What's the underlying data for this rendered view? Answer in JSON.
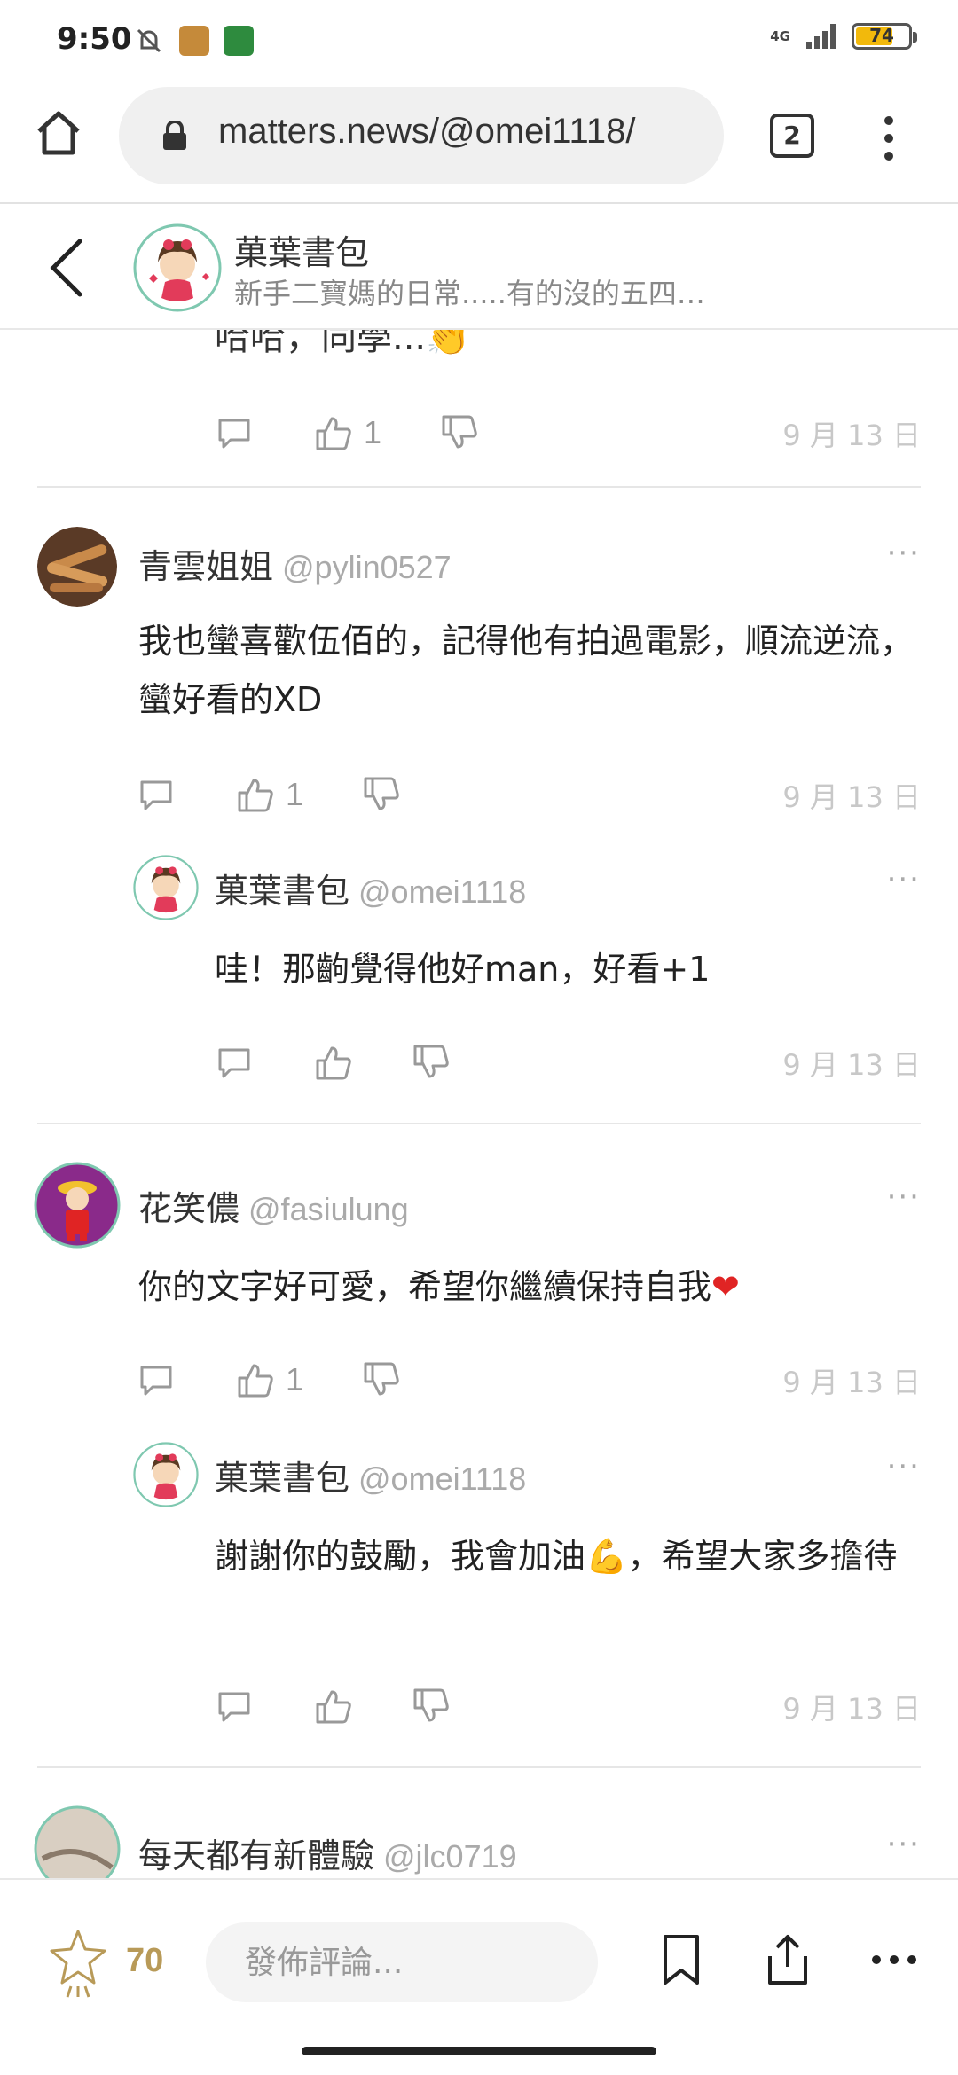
{
  "status_bar": {
    "time": "9:50",
    "network": "4G",
    "battery": "74"
  },
  "browser": {
    "url": "matters.news/@omei1118/",
    "tab_count": "2"
  },
  "profile": {
    "name": "菓葉書包",
    "description": "新手二寶媽的日常.....有的沒的五四…"
  },
  "partial_comment": {
    "text": "哈哈，同學...👏",
    "like_count": "1",
    "date": "9 月 13 日"
  },
  "comments": [
    {
      "name": "青雲姐姐",
      "handle": "@pylin0527",
      "text": "我也蠻喜歡伍佰的，記得他有拍過電影，順流逆流，蠻好看的XD",
      "like_count": "1",
      "date": "9 月 13 日",
      "reply": {
        "name": "菓葉書包",
        "handle": "@omei1118",
        "text": "哇！那齣覺得他好man，好看+1",
        "like_count": "",
        "date": "9 月 13 日"
      }
    },
    {
      "name": "花笑儂",
      "handle": "@fasiulung",
      "text": "你的文字好可愛，希望你繼續保持自我",
      "emoji": "❤",
      "like_count": "1",
      "date": "9 月 13 日",
      "reply": {
        "name": "菓葉書包",
        "handle": "@omei1118",
        "text_before": "謝謝你的鼓勵，我會加油",
        "emoji": "💪",
        "text_after": "，希望大家多擔待",
        "like_count": "",
        "date": "9 月 13 日"
      }
    },
    {
      "name": "每天都有新體驗",
      "handle": "@jlc0719"
    }
  ],
  "more_label": "···",
  "bottom_bar": {
    "appreciation_count": "70",
    "comment_placeholder": "發佈評論..."
  },
  "icons": {
    "home": "home-icon",
    "lock": "lock-icon",
    "menu": "more-vert-icon",
    "back": "chevron-left-icon",
    "comment": "comment-bubble-icon",
    "like": "thumbs-up-icon",
    "dislike": "thumbs-down-icon",
    "star": "star-icon",
    "bookmark": "bookmark-icon",
    "share": "share-icon",
    "more": "more-horiz-icon"
  },
  "colors": {
    "accent_gold": "#b89a58",
    "muted": "#c8c8c8",
    "divider": "#e6e6e6"
  }
}
